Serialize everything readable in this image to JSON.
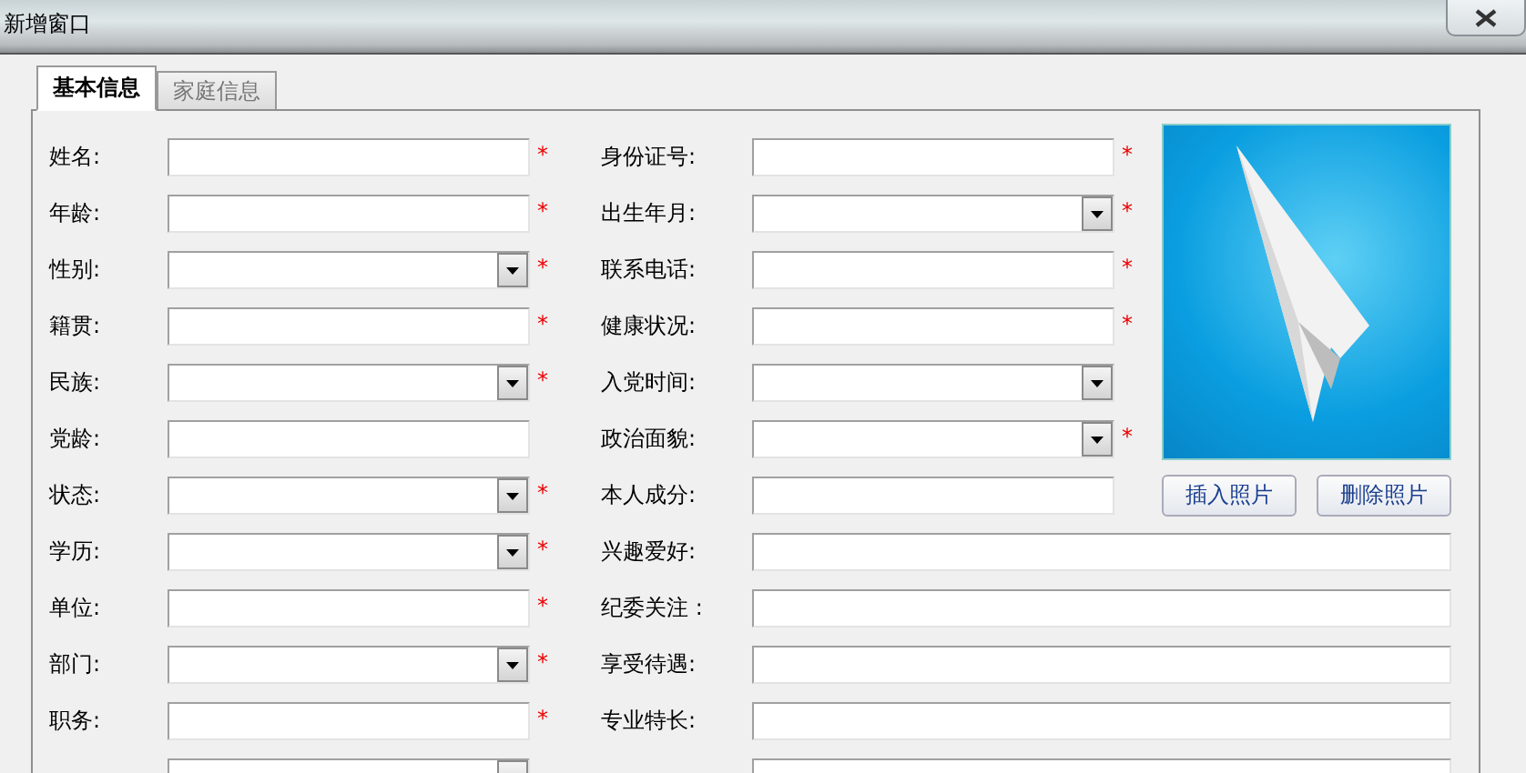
{
  "window": {
    "title": "新增窗口"
  },
  "tabs": [
    {
      "label": "基本信息",
      "selected": true
    },
    {
      "label": "家庭信息",
      "selected": false
    }
  ],
  "form": {
    "rows": [
      {
        "left": {
          "label": "姓名:",
          "kind": "text",
          "mark": "*"
        },
        "right": {
          "label": "身份证号:",
          "kind": "text",
          "mark": "*"
        }
      },
      {
        "left": {
          "label": "年龄:",
          "kind": "text",
          "mark": "*"
        },
        "right": {
          "label": "出生年月:",
          "kind": "select",
          "mark": "*"
        }
      },
      {
        "left": {
          "label": "性别:",
          "kind": "select",
          "mark": "*"
        },
        "right": {
          "label": "联系电话:",
          "kind": "text",
          "mark": "*"
        }
      },
      {
        "left": {
          "label": "籍贯:",
          "kind": "text",
          "mark": "*"
        },
        "right": {
          "label": "健康状况:",
          "kind": "text",
          "mark": "*"
        }
      },
      {
        "left": {
          "label": "民族:",
          "kind": "select",
          "mark": "*"
        },
        "right": {
          "label": "入党时间:",
          "kind": "select"
        }
      },
      {
        "left": {
          "label": "党龄:",
          "kind": "text"
        },
        "right": {
          "label": "政治面貌:",
          "kind": "select",
          "mark": "*"
        }
      },
      {
        "left": {
          "label": "状态:",
          "kind": "select",
          "mark": "*"
        },
        "right": {
          "label": "本人成分:",
          "kind": "text"
        }
      },
      {
        "left": {
          "label": "学历:",
          "kind": "select",
          "mark": "*"
        },
        "right": {
          "label": "兴趣爱好:",
          "kind": "text"
        }
      },
      {
        "left": {
          "label": "单位:",
          "kind": "text",
          "mark": "*"
        },
        "right": {
          "label": "纪委关注 :",
          "kind": "text"
        }
      },
      {
        "left": {
          "label": "部门:",
          "kind": "select",
          "mark": "*"
        },
        "right": {
          "label": "享受待遇:",
          "kind": "text"
        }
      },
      {
        "left": {
          "label": "职务:",
          "kind": "text",
          "mark": "*"
        },
        "right": {
          "label": "专业特长:",
          "kind": "text"
        }
      },
      {
        "left": {
          "kind": "select"
        },
        "right": {
          "kind": "text"
        }
      }
    ]
  },
  "photo": {
    "buttons": [
      "插入照片",
      "删除照片"
    ]
  }
}
